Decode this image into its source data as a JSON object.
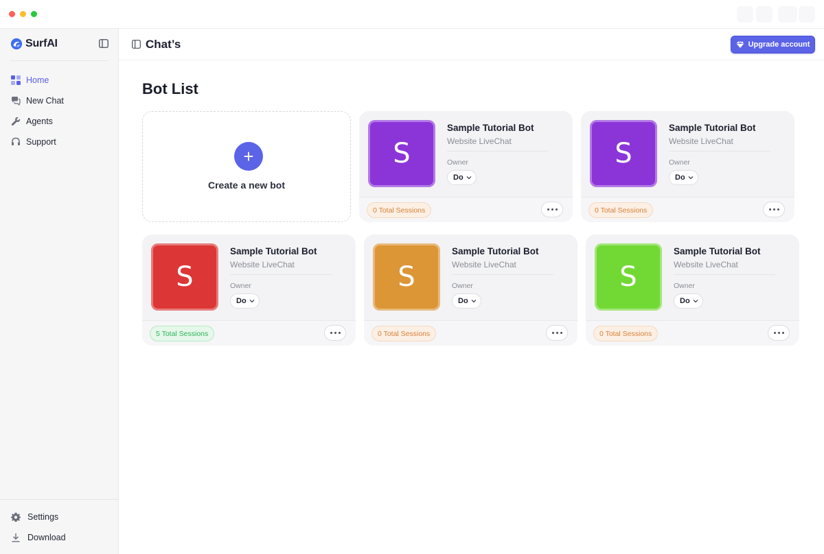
{
  "app": {
    "name": "SurfAI",
    "page_title": "Chat’s",
    "upgrade_label": "Upgrade account",
    "accent": "#5b63e6"
  },
  "sidebar": {
    "items": [
      {
        "label": "Home",
        "icon": "grid-icon",
        "active": true
      },
      {
        "label": "New Chat",
        "icon": "chat-bubbles-icon",
        "active": false
      },
      {
        "label": "Agents",
        "icon": "wrench-icon",
        "active": false
      },
      {
        "label": "Support",
        "icon": "headset-icon",
        "active": false
      }
    ],
    "bottom_items": [
      {
        "label": "Settings",
        "icon": "gear-icon"
      },
      {
        "label": "Download",
        "icon": "download-icon"
      }
    ]
  },
  "main": {
    "heading": "Bot List",
    "create_label": "Create a new bot",
    "create_icon": "plus-icon",
    "bots": [
      {
        "name": "Sample Tutorial Bot",
        "type": "Website LiveChat",
        "owner_label": "Owner",
        "owner": "Do",
        "avatar_letter": "S",
        "color": "#8b35d9",
        "sessions": "0 Total Sessions",
        "sessions_state": "zero"
      },
      {
        "name": "Sample Tutorial Bot",
        "type": "Website LiveChat",
        "owner_label": "Owner",
        "owner": "Do",
        "avatar_letter": "S",
        "color": "#8b35d9",
        "sessions": "0 Total Sessions",
        "sessions_state": "zero"
      },
      {
        "name": "Sample Tutorial Bot",
        "type": "Website LiveChat",
        "owner_label": "Owner",
        "owner": "Do",
        "avatar_letter": "S",
        "color": "#dc3636",
        "sessions": "5 Total Sessions",
        "sessions_state": "active"
      },
      {
        "name": "Sample Tutorial Bot",
        "type": "Website LiveChat",
        "owner_label": "Owner",
        "owner": "Do",
        "avatar_letter": "S",
        "color": "#dc9636",
        "sessions": "0 Total Sessions",
        "sessions_state": "zero"
      },
      {
        "name": "Sample Tutorial Bot",
        "type": "Website LiveChat",
        "owner_label": "Owner",
        "owner": "Do",
        "avatar_letter": "S",
        "color": "#72d934",
        "sessions": "0 Total Sessions",
        "sessions_state": "zero"
      }
    ]
  }
}
